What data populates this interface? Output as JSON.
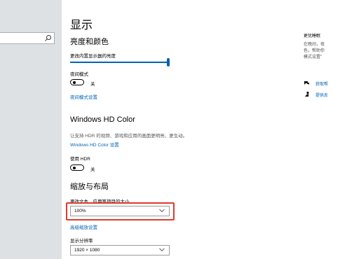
{
  "sidebar": {
    "search": {
      "placeholder": ""
    }
  },
  "main": {
    "page_title": "显示",
    "brightness_section": {
      "heading": "亮度和颜色",
      "brightness_label": "更改内置显示器的亮度",
      "brightness_level": 1.0,
      "night_light_label": "夜间模式",
      "night_light_state": "关",
      "night_light_link": "夜间模式设置"
    },
    "hdr_section": {
      "heading": "Windows HD Color",
      "description": "让支持 HDR 的视频、游戏和应用的画面更明亮、更生动。",
      "settings_link": "Windows HD Color 设置",
      "use_hdr_label": "使用 HDR",
      "use_hdr_state": "关"
    },
    "scale_section": {
      "heading": "缩放与布局",
      "scale_label": "更改文本、应用等项目的大小",
      "scale_value": "100%",
      "advanced_link": "高级缩放设置",
      "resolution_label": "显示分辨率",
      "resolution_value": "1920 × 1080"
    }
  },
  "right_panel": {
    "heading": "更优睡眠",
    "desc_lines": [
      "在晚间，夜",
      "色，帮助你",
      "模式设置\""
    ],
    "links": [
      "获取帮",
      "提供反"
    ]
  },
  "colors": {
    "accent": "#0063b1",
    "highlight": "#e23a2d",
    "sidebar_bg": "#dde1e4"
  }
}
